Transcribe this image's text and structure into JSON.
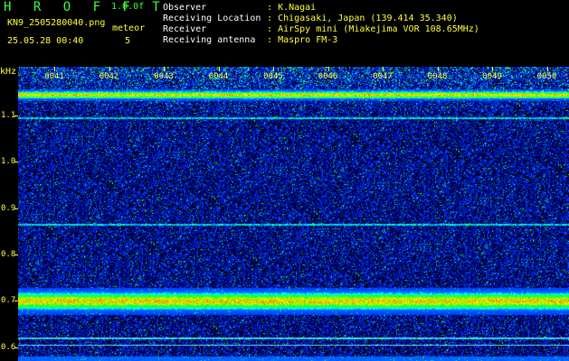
{
  "header": {
    "app_title": "H R O F F T",
    "version": "1.0.0f",
    "filename": "KN9_2505280040.png",
    "timestamp": "25.05.28 00:40",
    "meteor_label": "meteor",
    "meteor_count": "5"
  },
  "info": [
    {
      "key": "Observer",
      "sep": ":",
      "value": "K.Nagai"
    },
    {
      "key": "Receiving Location",
      "sep": ":",
      "value": "Chigasaki, Japan (139.414 35.340)"
    },
    {
      "key": "Receiver",
      "sep": ":",
      "value": "AirSpy mini (Miakejima VOR 108.65MHz)"
    },
    {
      "key": "Receiving antenna",
      "sep": ":",
      "value": "Maspro FM-3"
    }
  ],
  "colors": {
    "label_green": "#3cff3c",
    "label_yellow": "#ffff3c",
    "background": "#000000"
  },
  "chart_data": {
    "type": "heatmap",
    "ylabel": "kHz",
    "y_ticks": [
      "1.1",
      "1.0",
      "0.9",
      "0.8",
      "0.7",
      "0.6"
    ],
    "y_tick_values": [
      1.1,
      1.0,
      0.9,
      0.8,
      0.7,
      0.6
    ],
    "x_ticks": [
      "0041",
      "0042",
      "0043",
      "0044",
      "0045",
      "0046",
      "0047",
      "0048",
      "0049",
      "0050"
    ],
    "ylim": [
      0.57,
      1.205
    ],
    "strong_bands_khz": [
      1.145,
      0.7
    ],
    "weak_lines_khz": [
      1.095,
      0.865,
      0.62,
      0.605
    ],
    "grid": false
  }
}
